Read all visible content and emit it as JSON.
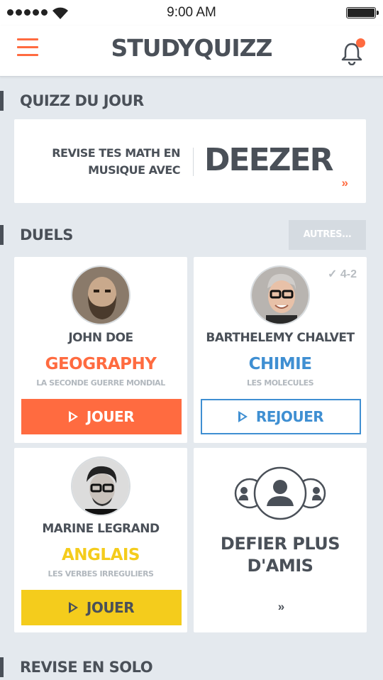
{
  "status": {
    "time": "9:00 AM"
  },
  "header": {
    "title": "STUDYQUIZZ"
  },
  "sections": {
    "quiz_du_jour": "QUIZZ DU JOUR",
    "duels": "DUELS",
    "revise_solo": "REVISE EN SOLO"
  },
  "quiz_card": {
    "line1": "REVISE TES MATH EN",
    "line2": "MUSIQUE AVEC",
    "brand": "DEEZER",
    "more": "»"
  },
  "duels": {
    "autres_label": "AUTRES...",
    "cards": [
      {
        "player": "JOHN DOE",
        "subject": "GEOGRAPHY",
        "topic": "LA SECONDE GUERRE MONDIAL",
        "button": "JOUER",
        "subject_color": "#ff6b40"
      },
      {
        "player": "BARTHELEMY CHALVET",
        "subject": "CHIMIE",
        "topic": "LES MOLECULES",
        "button": "REJOUER",
        "score": "4-2",
        "subject_color": "#3f8fd2"
      },
      {
        "player": "MARINE LEGRAND",
        "subject": "ANGLAIS",
        "topic": "LES VERBES IRREGULIERS",
        "button": "JOUER",
        "subject_color": "#f4cc1c"
      }
    ],
    "defier": {
      "line1": "DEFIER PLUS",
      "line2": "D'AMIS",
      "more": "»"
    }
  },
  "colors": {
    "accent": "#ff6b40",
    "blue": "#3f8fd2",
    "yellow": "#f4cc1c",
    "text": "#4a5058",
    "background": "#e4e9ee"
  },
  "icons": {
    "menu": "hamburger-icon",
    "notifications": "bell-icon",
    "play": "play-icon",
    "check": "check-icon",
    "friends": "people-icon"
  }
}
